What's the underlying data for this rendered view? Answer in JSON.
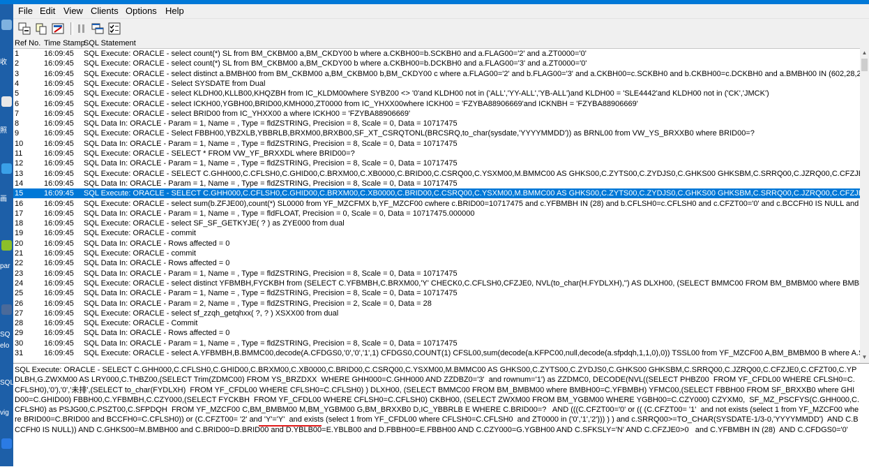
{
  "menu": {
    "file": "File",
    "edit": "Edit",
    "view": "View",
    "clients": "Clients",
    "options": "Options",
    "help": "Help"
  },
  "columns": {
    "ref": "Ref No.",
    "time": "Time Stamp",
    "sql": "SQL Statement"
  },
  "desktop_fragments": [
    "收",
    "照",
    "画",
    "par",
    "SQ",
    "SQL",
    "vig",
    "elo"
  ],
  "rows": [
    {
      "ref": "1",
      "time": "16:09:45",
      "sql": "SQL Execute: ORACLE -  select count(*) SL from BM_CKBM00 a,BM_CKDY00 b where a.CKBH00=b.SCKBH0 and a.FLAG00='2' and a.ZT0000='0'"
    },
    {
      "ref": "2",
      "time": "16:09:45",
      "sql": "SQL Execute: ORACLE -  select count(*) SL from BM_CKBM00 a,BM_CKDY00 b where a.CKBH00=b.DCKBH0 and a.FLAG00='3' and a.ZT0000='0'"
    },
    {
      "ref": "3",
      "time": "16:09:45",
      "sql": "SQL Execute: ORACLE -  select distinct a.BMBH00 from BM_CKBM00 a,BM_CKBM00 b,BM_CKDY00 c where a.FLAG00='2' and b.FLAG00='3' and a.CKBH00=c.SCKBH0 and b.CKBH00=c.DCKBH0 and a.BMBH00 IN (602,28,29) and b.BMBH00"
    },
    {
      "ref": "4",
      "time": "16:09:45",
      "sql": "SQL Execute: ORACLE -  Select SYSDATE from Dual"
    },
    {
      "ref": "5",
      "time": "16:09:45",
      "sql": "SQL Execute: ORACLE -  select KLDH00,KLLB00,KHQZBH from IC_KLDM00where SYBZ00 <> '0'and KLDH00 not in ('ALL','YY-ALL','YB-ALL')and KLDH00 = 'SLE4442'and KLDH00 not in ('CK','JMCK')"
    },
    {
      "ref": "6",
      "time": "16:09:45",
      "sql": "SQL Execute: ORACLE -  select ICKH00,YGBH00,BRID00,KMH000,ZT0000 from IC_YHXX00where ICKH00 = 'FZYBA88906669'and ICKNBH = 'FZYBA88906669'"
    },
    {
      "ref": "7",
      "time": "16:09:45",
      "sql": "SQL Execute: ORACLE -  select BRID00 from IC_YHXX00 a    where ICKH00 = 'FZYBA88906669'"
    },
    {
      "ref": "8",
      "time": "16:09:45",
      "sql": "SQL Data In: ORACLE - Param = 1, Name = , Type = fldZSTRING, Precision = 8, Scale = 0, Data = 10717475"
    },
    {
      "ref": "9",
      "time": "16:09:45",
      "sql": "SQL Execute: ORACLE -  Select FBBH00,YBZXLB,YBBRLB,BRXM00,BRXB00,SF_XT_CSRQTONL(BRCSRQ,to_char(sysdate,'YYYYMMDD')) as BRNL00 from VW_YS_BRXXB0 where BRID00=?"
    },
    {
      "ref": "10",
      "time": "16:09:45",
      "sql": "SQL Data In: ORACLE - Param = 1, Name = , Type = fldZSTRING, Precision = 8, Scale = 0, Data = 10717475"
    },
    {
      "ref": "11",
      "time": "16:09:45",
      "sql": "SQL Execute: ORACLE -  SELECT * FROM VW_YF_BRXXDL where BRID00=?"
    },
    {
      "ref": "12",
      "time": "16:09:45",
      "sql": "SQL Data In: ORACLE - Param = 1, Name = , Type = fldZSTRING, Precision = 8, Scale = 0, Data = 10717475"
    },
    {
      "ref": "13",
      "time": "16:09:45",
      "sql": "SQL Execute: ORACLE -  SELECT C.GHH000,C.CFLSH0,C.GHID00,C.BRXM00,C.XB0000,C.BRID00,C.CSRQ00,C.YSXM00,M.BMMC00 AS GHKS00,C.ZYTS00,C.ZYDJS0,C.GHKS00 GHKSBM,C.SRRQ00,C.JZRQ00,C.CFZJE0,C.CFZT00,C.YPD"
    },
    {
      "ref": "14",
      "time": "16:09:45",
      "sql": "SQL Data In: ORACLE - Param = 1, Name = , Type = fldZSTRING, Precision = 8, Scale = 0, Data = 10717475"
    },
    {
      "ref": "15",
      "time": "16:09:45",
      "sql": "SQL Execute: ORACLE -  SELECT C.GHH000,C.CFLSH0,C.GHID00,C.BRXM00,C.XB0000,C.BRID00,C.CSRQ00,C.YSXM00,M.BMMC00 AS GHKS00,C.ZYTS00,C.ZYDJS0,C.GHKS00 GHKSBM,C.SRRQ00,C.JZRQ00,C.CFZJE0,C.CFZT00,C.YPD",
      "selected": true
    },
    {
      "ref": "16",
      "time": "16:09:45",
      "sql": "SQL Execute: ORACLE -  select sum(b.ZFJE00),count(*) SL0000 from YF_MZCFMX b,YF_MZCF00 cwhere  c.BRID00=10717475  and c.YFBMBH IN (28) and b.CFLSH0=c.CFLSH0 and c.CFZT00='0'  and c.BCCFH0 IS NULL and c.SRRQ00>=TO"
    },
    {
      "ref": "17",
      "time": "16:09:45",
      "sql": "SQL Data In: ORACLE - Param = 1, Name = , Type = fldFLOAT, Precision = 0, Scale = 0, Data = 10717475.000000"
    },
    {
      "ref": "18",
      "time": "16:09:45",
      "sql": "SQL Execute: ORACLE -  select SF_SF_GETKYJE( ? ) as ZYE000 from dual"
    },
    {
      "ref": "19",
      "time": "16:09:45",
      "sql": "SQL Execute: ORACLE -  commit"
    },
    {
      "ref": "20",
      "time": "16:09:45",
      "sql": "SQL Data In: ORACLE - Rows affected = 0"
    },
    {
      "ref": "21",
      "time": "16:09:45",
      "sql": "SQL Execute: ORACLE -  commit"
    },
    {
      "ref": "22",
      "time": "16:09:45",
      "sql": "SQL Data In: ORACLE - Rows affected = 0"
    },
    {
      "ref": "23",
      "time": "16:09:45",
      "sql": "SQL Data In: ORACLE - Param = 1, Name = , Type = fldZSTRING, Precision = 8, Scale = 0, Data = 10717475"
    },
    {
      "ref": "24",
      "time": "16:09:45",
      "sql": "SQL Execute: ORACLE -  select distinct YFBMBH,FYCKBH from (SELECT C.YFBMBH,C.BRXM00,'Y' CHECK0,C.CFLSH0,CFZJE0, NVL(to_char(H.FYDLXH),'') AS DLXH00,  (SELECT BMMC00 FROM BM_BMBM00 where BMBH00=C.YFBMBH) YI"
    },
    {
      "ref": "25",
      "time": "16:09:45",
      "sql": "SQL Data In: ORACLE - Param = 1, Name = , Type = fldZSTRING, Precision = 8, Scale = 0, Data = 10717475"
    },
    {
      "ref": "26",
      "time": "16:09:45",
      "sql": "SQL Data In: ORACLE - Param = 2, Name = , Type = fldZSTRING, Precision = 2, Scale = 0, Data = 28"
    },
    {
      "ref": "27",
      "time": "16:09:45",
      "sql": "SQL Execute: ORACLE -  select sf_zzqh_getqhxx( ?, ? ) XSXX00 from dual"
    },
    {
      "ref": "28",
      "time": "16:09:45",
      "sql": "SQL Execute: ORACLE -  Commit"
    },
    {
      "ref": "29",
      "time": "16:09:45",
      "sql": "SQL Data In: ORACLE - Rows affected = 0"
    },
    {
      "ref": "30",
      "time": "16:09:45",
      "sql": "SQL Data In: ORACLE - Param = 1, Name = , Type = fldZSTRING, Precision = 8, Scale = 0, Data = 10717475"
    },
    {
      "ref": "31",
      "time": "16:09:45",
      "sql": "SQL Execute: ORACLE -  select A.YFBMBH,B.BMMC00,decode(A.CFDGS0,'0','0','1',1) CFDGS0,COUNT(1) CFSL00,sum(decode(a.KFPC00,null,decode(a.sfpdqh,1,1,0),0)) TSSL00  from YF_MZCF00 A,BM_BMBM00 B where  A.SRRQ00>=TO_CHA"
    }
  ],
  "detail_text": "SQL Execute: ORACLE - SELECT C.GHH000,C.CFLSH0,C.GHID00,C.BRXM00,C.XB0000,C.BRID00,C.CSRQ00,C.YSXM00,M.BMMC00 AS GHKS00,C.ZYTS00,C.ZYDJS0,C.GHKS00 GHKSBM,C.SRRQ00,C.JZRQ00,C.CFZJE0,C.CFZT00,C.YPDLBH,G.ZWXM00 AS LRY000,C.THBZ00,(SELECT Trim(ZDMC00) FROM YS_BRZDXX  WHERE GHH000=C.GHH000 AND ZZDBZ0='3'  and rownum='1') as ZZDMC0, DECODE(NVL((SELECT PHBZ00  FROM YF_CFDL00 WHERE CFLSH0=C.CFLSH0),'0'),'0','未排',(SELECT to_char(FYDLXH)  FROM YF_CFDL00 WHERE CFLSH0=C.CFLSH0) ) DLXH00, (SELECT BMMC00 FROM BM_BMBM00 where BMBH00=C.YFBMBH) YFMC00,(SELECT FBBH00 FROM SF_BRXXB0 where GHID00=C.GHID00) FBBH00,C.YFBMBH,C.CZY000,(SELECT FYCKBH  FROM YF_CFDL00 WHERE CFLSH0=C.CFLSH0) CKBH00, (SELECT ZWXM00 FROM BM_YGBM00 WHERE YGBH00=C.CZY000) CZYXM0,  SF_MZ_PSCFYS(C.GHH000,C.CFLSH0) as PSJG00,C.PSZT00,C.SFPDQH  FROM YF_MZCF00 C,BM_BMBM00 M,BM_YGBM00 G,BM_BRXXB0 D,IC_YBBRLB E WHERE C.BRID00=?   AND (((C.CFZT00='0' or (( (C.CFZT00= '1'  and not exists (select 1 from YF_MZCF00 where BRID00=C.BRID00 and BCCFH0=C.CFLSH0)) or (C.CFZT00= '2' and 'Y'='Y'  and exists (select 1 from YF_CFDL00 where CFLSH0=C.CFLSH0  and ZT0000 in ('0','1','2'))) ) ) and c.SRRQ00>=TO_CHAR(SYSDATE-1/3-0,'YYYYMMDD')  AND C.BCCFH0 IS NULL)) AND C.GHKS00=M.BMBH00 and C.BRID00=D.BRID00 and D.YBLB00=E.YBLB00 and D.FBBH00=E.FBBH00 AND C.CZY000=G.YGBH00 AND C.SFKSLY='N' AND C.CFZJE0>0   and C.YFBMBH IN (28)  AND C.CFDGS0='0'"
}
